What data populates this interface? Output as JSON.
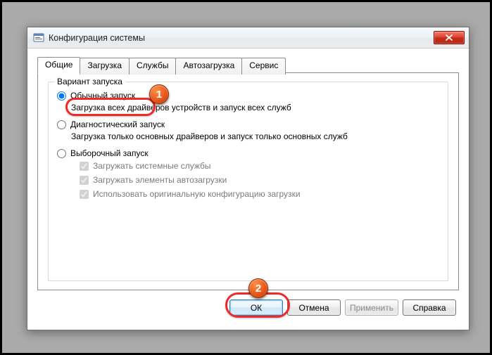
{
  "title": "Конфигурация системы",
  "tabs": {
    "general": "Общие",
    "boot": "Загрузка",
    "services": "Службы",
    "startup": "Автозагрузка",
    "tools": "Сервис"
  },
  "group": {
    "title": "Вариант запуска",
    "normal": {
      "label": "Обычный запуск",
      "desc": "Загрузка всех драйверов устройств и запуск всех служб"
    },
    "diag": {
      "label": "Диагностический запуск",
      "desc": "Загрузка только основных драйверов и запуск только основных служб"
    },
    "select": {
      "label": "Выборочный запуск"
    },
    "checks": {
      "c1": "Загружать системные службы",
      "c2": "Загружать элементы автозагрузки",
      "c3": "Использовать оригинальную конфигурацию загрузки"
    }
  },
  "buttons": {
    "ok": "ОК",
    "cancel": "Отмена",
    "apply": "Применить",
    "help": "Справка"
  },
  "callouts": {
    "c1": "1",
    "c2": "2"
  }
}
